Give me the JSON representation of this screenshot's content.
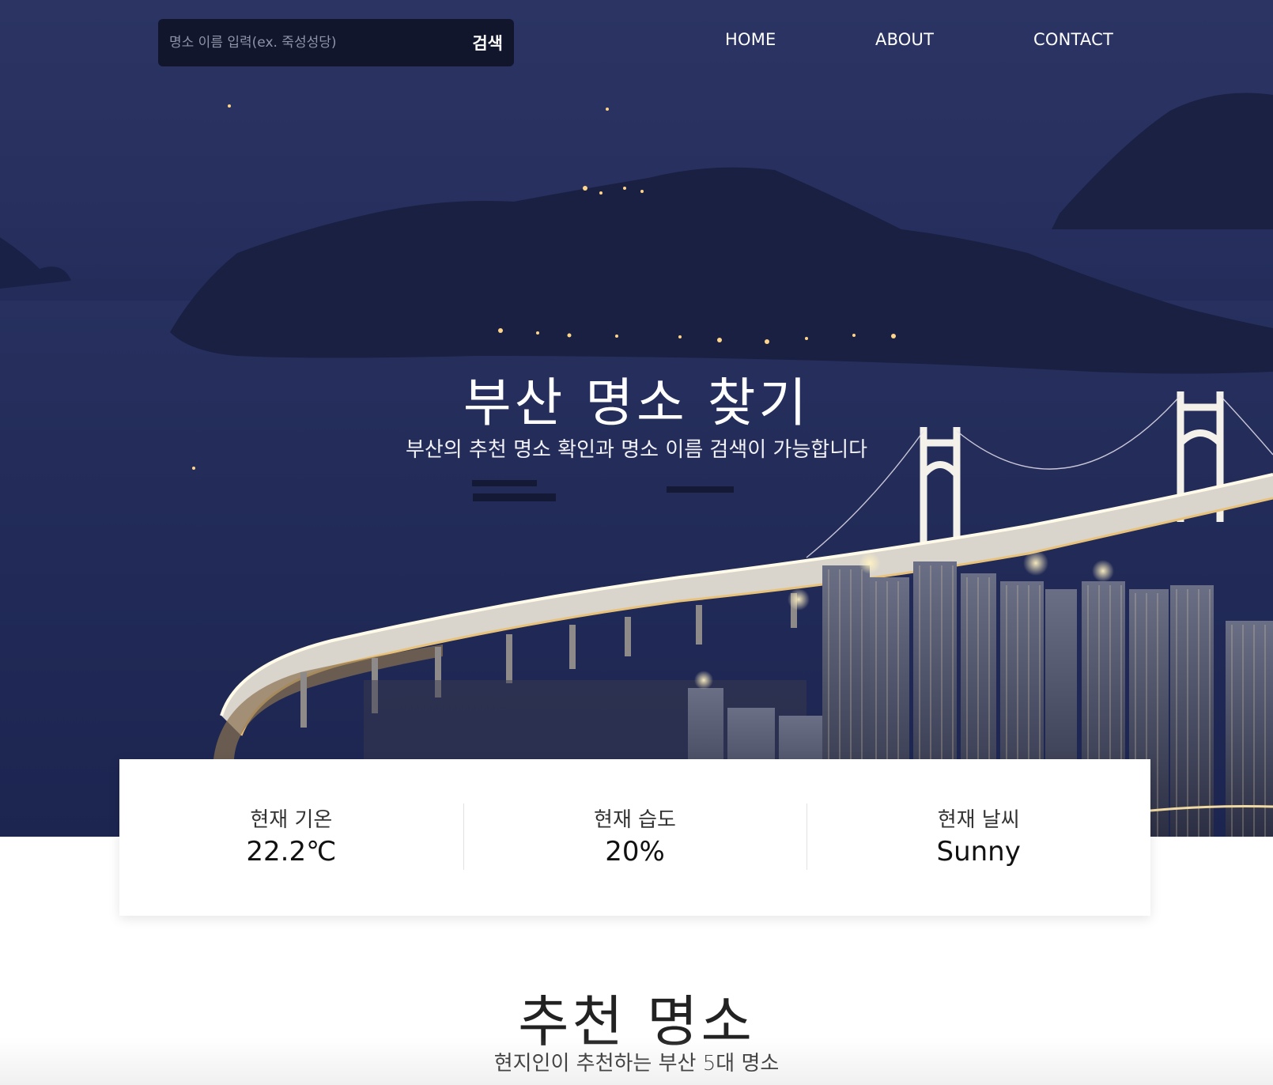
{
  "search": {
    "placeholder": "명소 이름 입력(ex. 죽성성당)",
    "value": "",
    "button_label": "검색"
  },
  "nav": {
    "items": [
      {
        "label": "HOME"
      },
      {
        "label": "ABOUT"
      },
      {
        "label": "CONTACT"
      }
    ]
  },
  "hero": {
    "title": "부산 명소 찾기",
    "subtitle": "부산의 추천 명소 확인과 명소 이름 검색이 가능합니다"
  },
  "weather": {
    "temperature": {
      "label": "현재 기온",
      "value": "22.2℃"
    },
    "humidity": {
      "label": "현재 습도",
      "value": "20%"
    },
    "condition": {
      "label": "현재 날씨",
      "value": "Sunny"
    }
  },
  "recommend": {
    "title": "추천 명소",
    "subtitle": "현지인이 추천하는 부산 5대 명소"
  },
  "colors": {
    "hero_sky": "#2b3463",
    "hero_sea": "#1f2a57",
    "bridge_lights": "#f5f0e0",
    "city_lights": "#e8c77a",
    "search_bg": "#0e1224"
  }
}
